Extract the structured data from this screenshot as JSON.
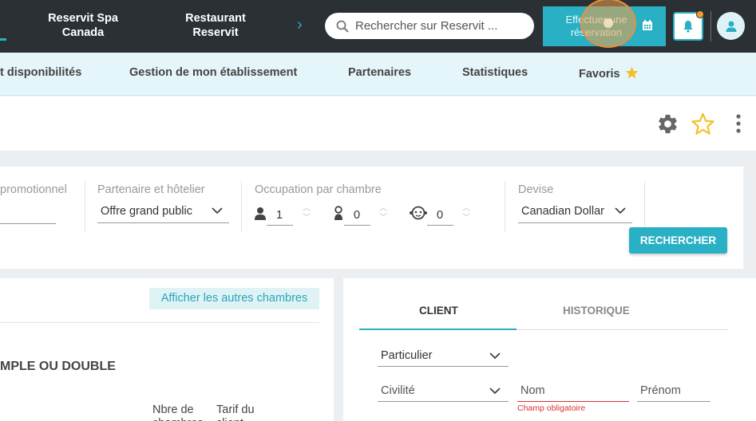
{
  "topbar": {
    "nav": [
      "Reservit Spa Canada",
      "Restaurant Reservit"
    ],
    "search_placeholder": "Rechercher sur Reservit ...",
    "reserve_label": "Effectuer une réservation",
    "accent_color": "#2ab0c5",
    "notification_dot_color": "#f39c28"
  },
  "subnav": {
    "items": [
      "t disponibilités",
      "Gestion de mon établissement",
      "Partenaires",
      "Statistiques",
      "Favoris"
    ]
  },
  "search_panel": {
    "promo_label": "promotionnel",
    "partner_label": "Partenaire et hôtelier",
    "partner_value": "Offre grand public",
    "occupancy_label": "Occupation par chambre",
    "occupancy": {
      "adults": "1",
      "children": "0",
      "babies": "0"
    },
    "currency_label": "Devise",
    "currency_value": "Canadian Dollar",
    "search_button": "RECHERCHER"
  },
  "rooms_card": {
    "other_rooms_button": "Afficher les autres chambres",
    "room_title": "MPLE OU DOUBLE",
    "columns": [
      "Nbre de chambres",
      "Tarif du client"
    ]
  },
  "client_card": {
    "tabs": [
      "CLIENT",
      "HISTORIQUE"
    ],
    "type_value": "Particulier",
    "civility_placeholder": "Civilité",
    "name_placeholder": "Nom",
    "firstname_placeholder": "Prénom",
    "name_error": "Champ obligatoire"
  }
}
